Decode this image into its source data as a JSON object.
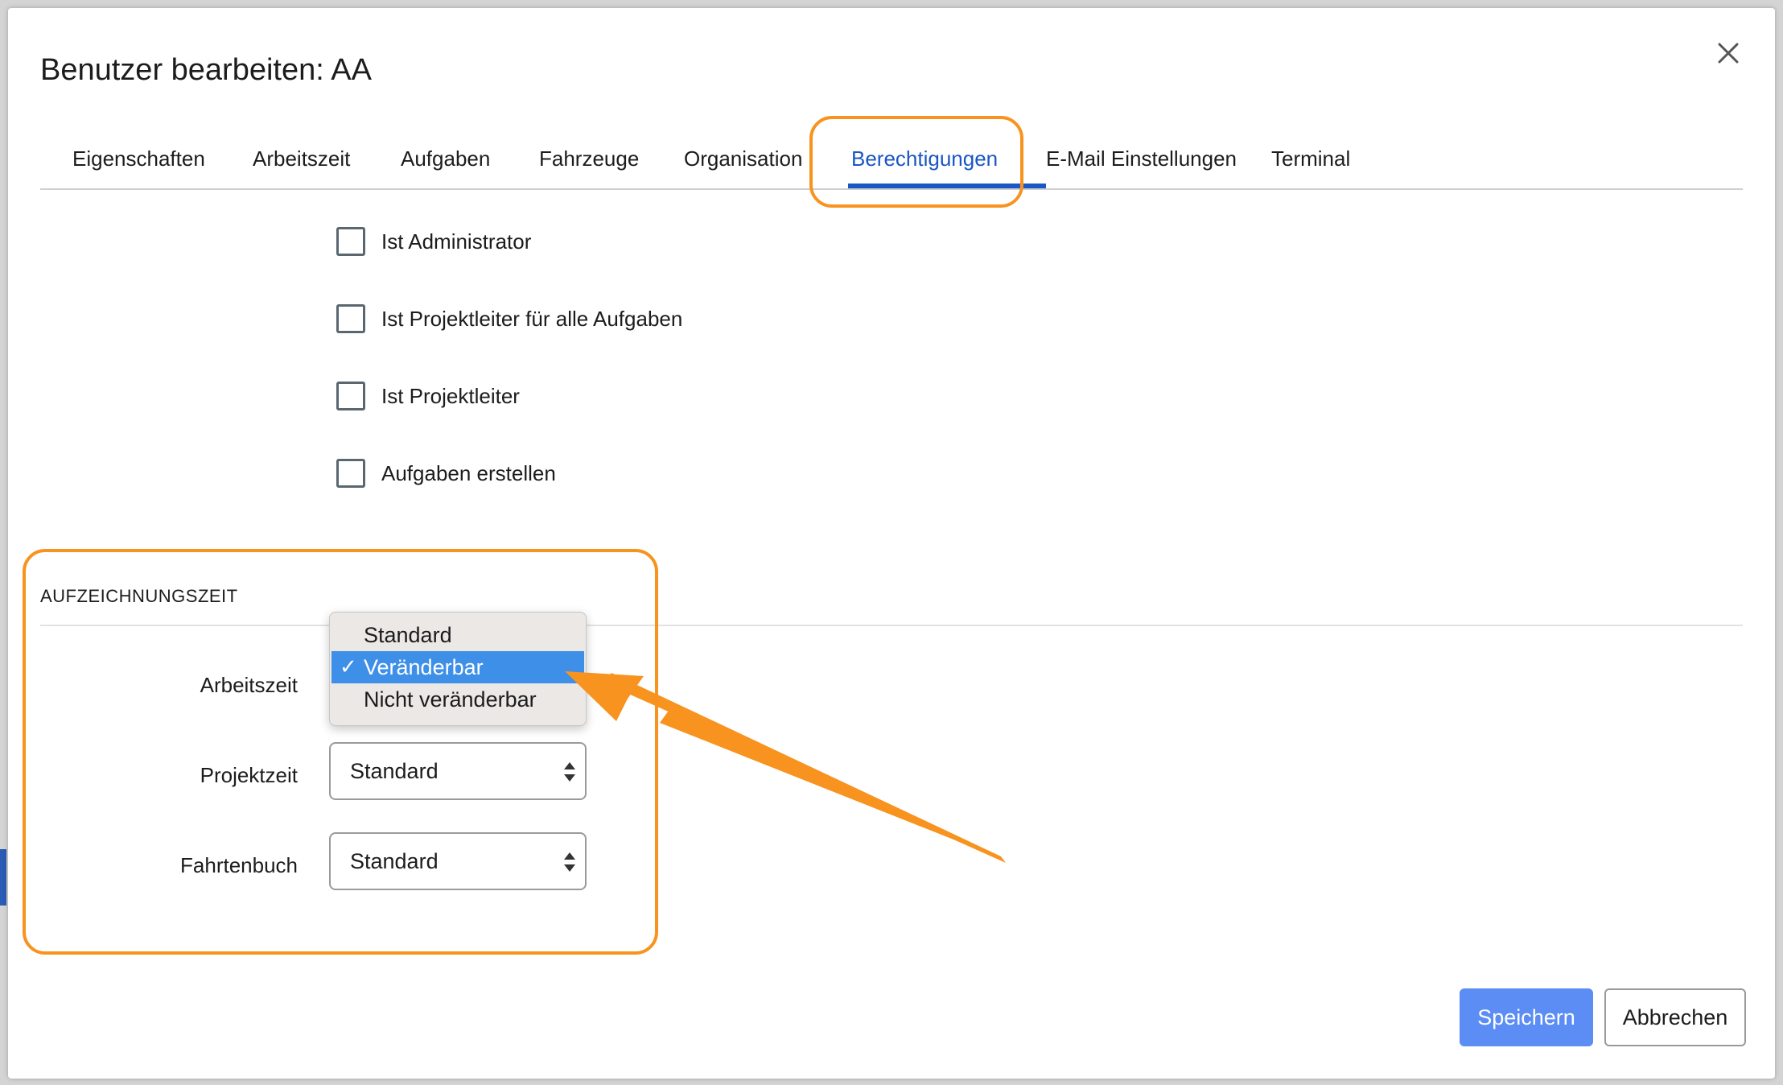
{
  "dialog": {
    "title": "Benutzer bearbeiten: AA",
    "close_icon": "close-icon"
  },
  "tabs": [
    {
      "label": "Eigenschaften"
    },
    {
      "label": "Arbeitszeit"
    },
    {
      "label": "Aufgaben"
    },
    {
      "label": "Fahrzeuge"
    },
    {
      "label": "Organisation"
    },
    {
      "label": "Berechtigungen",
      "active": true
    },
    {
      "label": "E-Mail Einstellungen"
    },
    {
      "label": "Terminal"
    }
  ],
  "permissions": [
    {
      "label": "Ist Administrator",
      "checked": false
    },
    {
      "label": "Ist Projektleiter für alle Aufgaben",
      "checked": false
    },
    {
      "label": "Ist Projektleiter",
      "checked": false
    },
    {
      "label": "Aufgaben erstellen",
      "checked": false
    }
  ],
  "recording_section": {
    "title": "AUFZEICHNUNGSZEIT",
    "fields": [
      {
        "label": "Arbeitszeit",
        "value": "Veränderbar"
      },
      {
        "label": "Projektzeit",
        "value": "Standard"
      },
      {
        "label": "Fahrtenbuch",
        "value": "Standard"
      }
    ],
    "dropdown_options": [
      {
        "label": "Standard",
        "selected": false
      },
      {
        "label": "Veränderbar",
        "selected": true
      },
      {
        "label": "Nicht veränderbar",
        "selected": false
      }
    ],
    "check_mark": "✓"
  },
  "footer": {
    "save_label": "Speichern",
    "cancel_label": "Abbrechen"
  },
  "colors": {
    "accent": "#1a56c4",
    "highlight": "#f7931e",
    "primary_button": "#5b8df5",
    "dropdown_selected": "#3d8fe8"
  }
}
